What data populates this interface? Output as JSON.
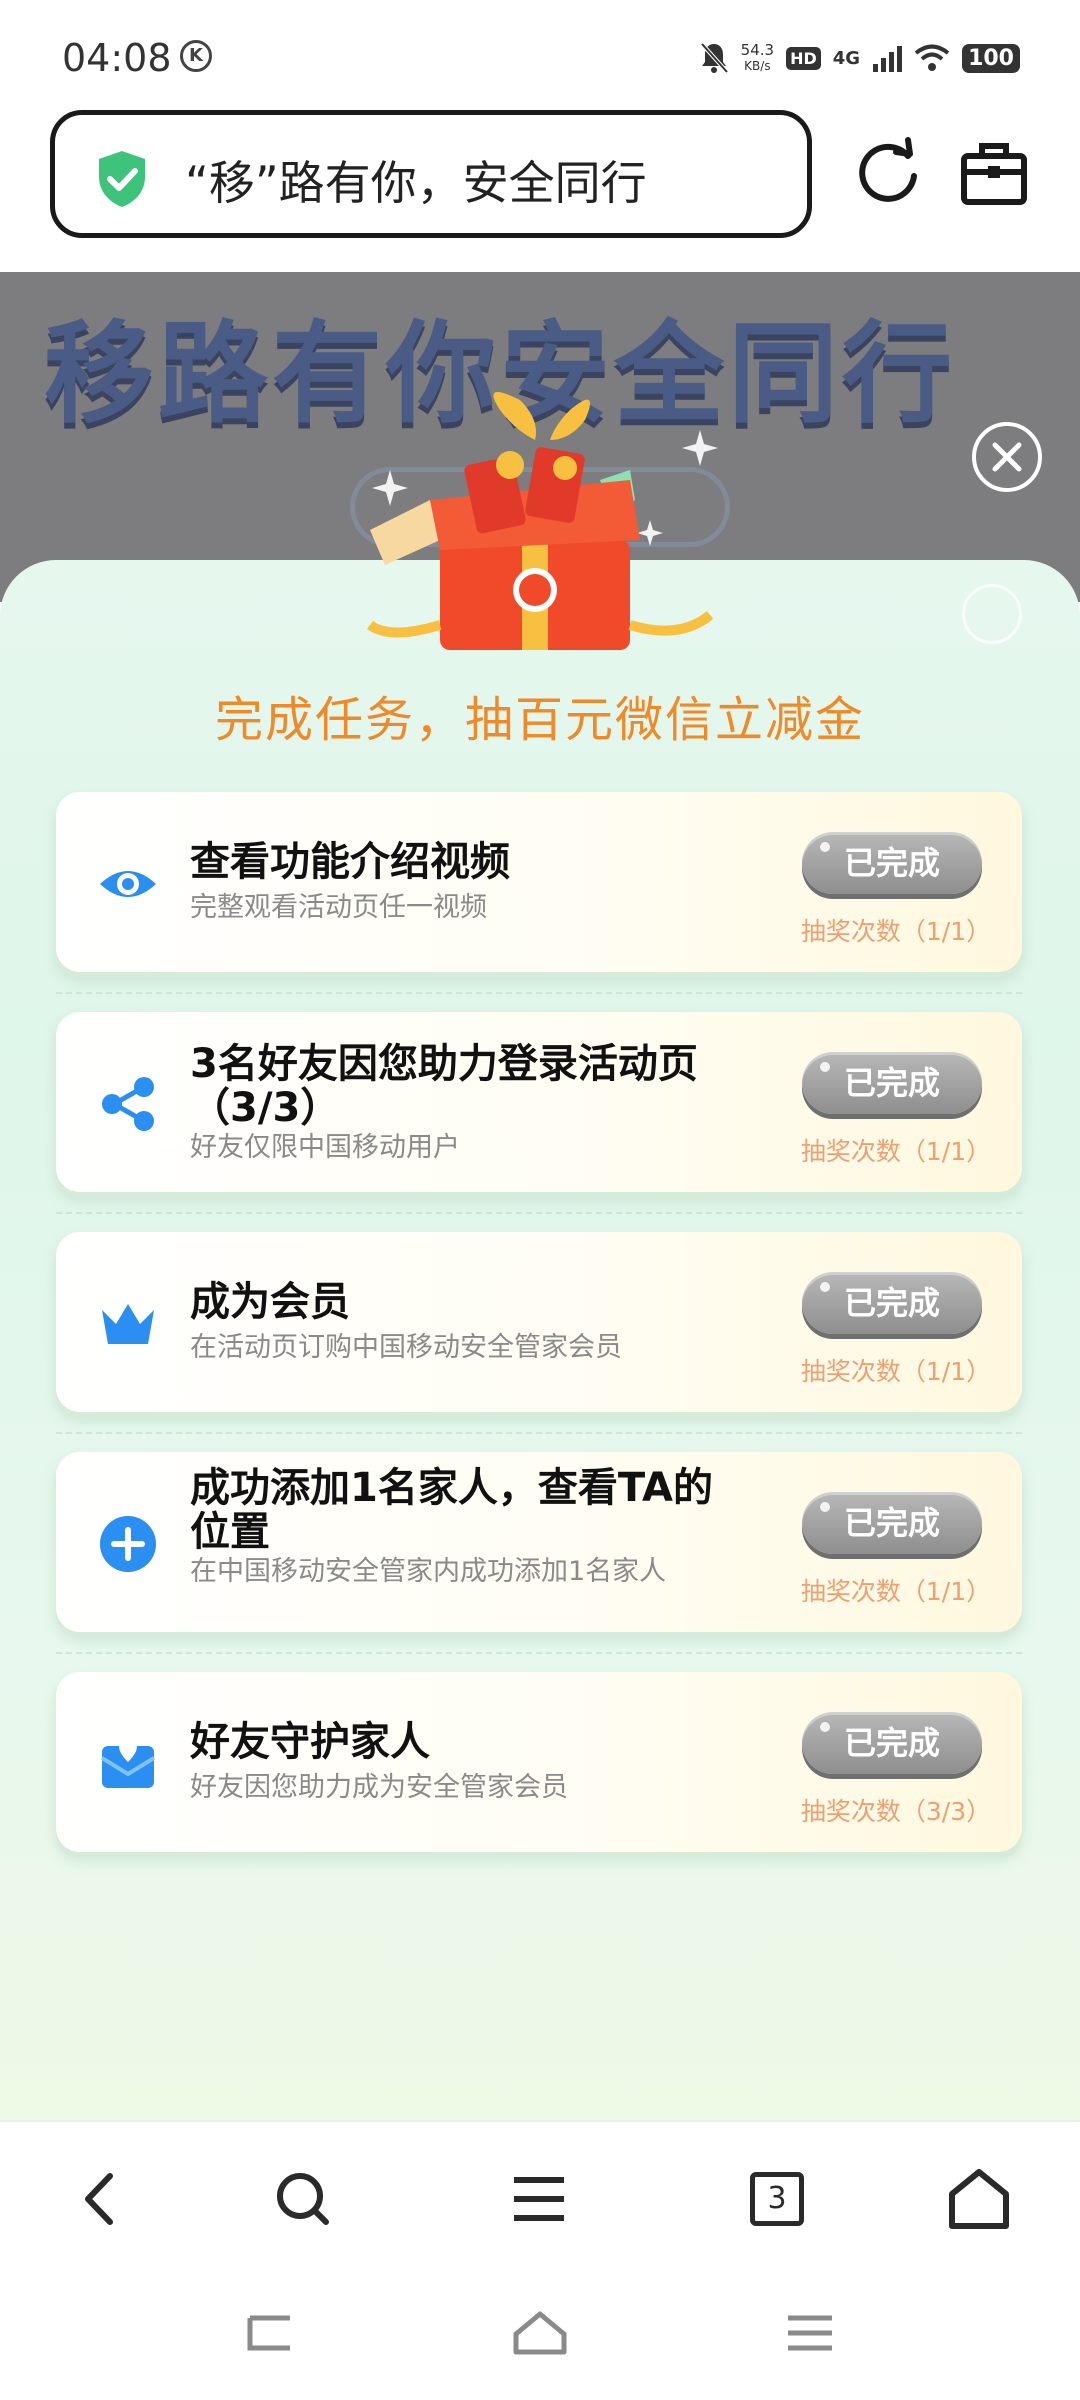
{
  "status_bar": {
    "time": "04:08",
    "net_speed": "54.3",
    "net_unit": "KB/s",
    "hd": "HD",
    "network": "4G",
    "battery": "100"
  },
  "address_bar": {
    "text": "“移”路有你，安全同行"
  },
  "background_page": {
    "banner_text": "移路有你安全同行"
  },
  "modal": {
    "title": "完成任务，抽百元微信立减金",
    "tasks": [
      {
        "icon": "eye-icon",
        "title": "查看功能介绍视频",
        "desc": "完整观看活动页任一视频",
        "button": "已完成",
        "count": "抽奖次数（1/1）"
      },
      {
        "icon": "share-icon",
        "title": "3名好友因您助力登录活动页（3/3）",
        "desc": "好友仅限中国移动用户",
        "button": "已完成",
        "count": "抽奖次数（1/1）"
      },
      {
        "icon": "crown-icon",
        "title": "成为会员",
        "desc": "在活动页订购中国移动安全管家会员",
        "button": "已完成",
        "count": "抽奖次数（1/1）"
      },
      {
        "icon": "add-circle-icon",
        "title": "成功添加1名家人，查看TA的位置",
        "desc": "在中国移动安全管家内成功添加1名家人",
        "button": "已完成",
        "count": "抽奖次数（1/1）"
      },
      {
        "icon": "heart-mail-icon",
        "title": "好友守护家人",
        "desc": "好友因您助力成为安全管家会员",
        "button": "已完成",
        "count": "抽奖次数（3/3）"
      }
    ]
  },
  "browser_nav": {
    "tabs_count": "3"
  },
  "colors": {
    "accent_orange": "#f08a28",
    "task_icon_blue": "#2a8ff0",
    "done_gray": "#9a9a9a"
  }
}
